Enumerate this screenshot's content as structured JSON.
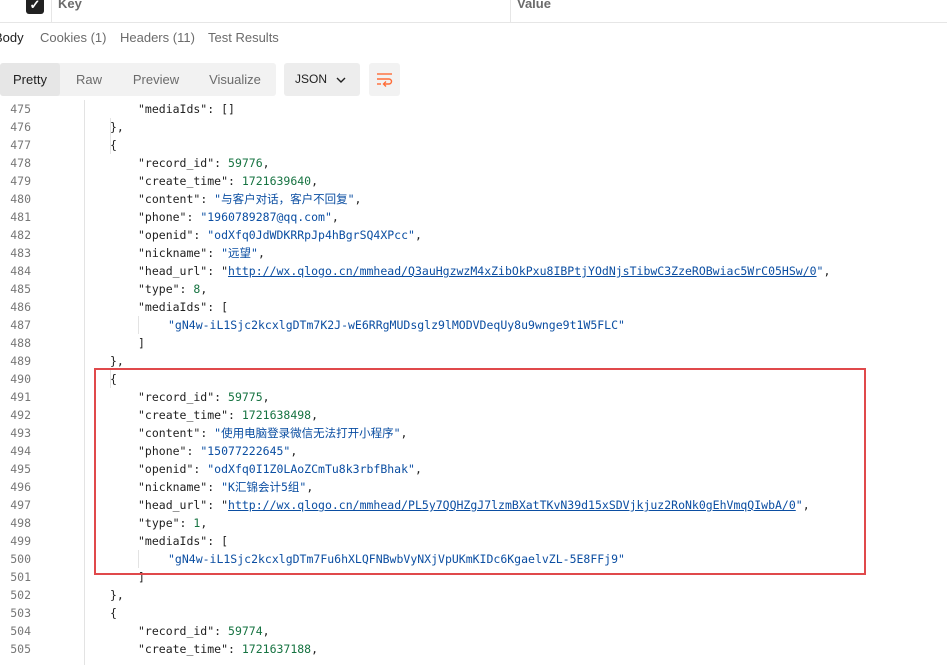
{
  "params_table": {
    "key_header": "Key",
    "value_header": "Value"
  },
  "response_tabs": [
    {
      "label": "Body",
      "active": true
    },
    {
      "label": "Cookies (1)",
      "active": false
    },
    {
      "label": "Headers (11)",
      "active": false
    },
    {
      "label": "Test Results",
      "active": false
    }
  ],
  "format_tabs": [
    {
      "label": "Pretty",
      "active": true
    },
    {
      "label": "Raw",
      "active": false
    },
    {
      "label": "Preview",
      "active": false
    },
    {
      "label": "Visualize",
      "active": false
    }
  ],
  "language_select": "JSON",
  "colors": {
    "accent": "#ff6c37",
    "highlight_box": "#e0494b",
    "string": "#0b4ea2",
    "number": "#167341"
  },
  "code_lines": [
    {
      "n": "475",
      "indent": 3,
      "tokens": [
        {
          "t": "k",
          "v": "\"mediaIds\""
        },
        {
          "t": "p",
          "v": ": []"
        }
      ]
    },
    {
      "n": "476",
      "indent": 2,
      "tokens": [
        {
          "t": "p",
          "v": "},"
        }
      ]
    },
    {
      "n": "477",
      "indent": 2,
      "tokens": [
        {
          "t": "p",
          "v": "{"
        }
      ]
    },
    {
      "n": "478",
      "indent": 3,
      "tokens": [
        {
          "t": "k",
          "v": "\"record_id\""
        },
        {
          "t": "p",
          "v": ": "
        },
        {
          "t": "n",
          "v": "59776"
        },
        {
          "t": "p",
          "v": ","
        }
      ]
    },
    {
      "n": "479",
      "indent": 3,
      "tokens": [
        {
          "t": "k",
          "v": "\"create_time\""
        },
        {
          "t": "p",
          "v": ": "
        },
        {
          "t": "n",
          "v": "1721639640"
        },
        {
          "t": "p",
          "v": ","
        }
      ]
    },
    {
      "n": "480",
      "indent": 3,
      "tokens": [
        {
          "t": "k",
          "v": "\"content\""
        },
        {
          "t": "p",
          "v": ": "
        },
        {
          "t": "s",
          "v": "\"与客户对话，客户不回复\""
        },
        {
          "t": "p",
          "v": ","
        }
      ]
    },
    {
      "n": "481",
      "indent": 3,
      "tokens": [
        {
          "t": "k",
          "v": "\"phone\""
        },
        {
          "t": "p",
          "v": ": "
        },
        {
          "t": "s",
          "v": "\"1960789287@qq.com\""
        },
        {
          "t": "p",
          "v": ","
        }
      ]
    },
    {
      "n": "482",
      "indent": 3,
      "tokens": [
        {
          "t": "k",
          "v": "\"openid\""
        },
        {
          "t": "p",
          "v": ": "
        },
        {
          "t": "s",
          "v": "\"odXfq0JdWDKRRpJp4hBgrSQ4XPcc\""
        },
        {
          "t": "p",
          "v": ","
        }
      ]
    },
    {
      "n": "483",
      "indent": 3,
      "tokens": [
        {
          "t": "k",
          "v": "\"nickname\""
        },
        {
          "t": "p",
          "v": ": "
        },
        {
          "t": "s",
          "v": "\"远望\""
        },
        {
          "t": "p",
          "v": ","
        }
      ]
    },
    {
      "n": "484",
      "indent": 3,
      "tokens": [
        {
          "t": "k",
          "v": "\"head_url\""
        },
        {
          "t": "p",
          "v": ": \""
        },
        {
          "t": "u",
          "v": "http://wx.qlogo.cn/mmhead/Q3auHgzwzM4xZibOkPxu8IBPtjYOdNjsTibwC3ZzeROBwiac5WrC05HSw/0"
        },
        {
          "t": "s",
          "v": "\""
        },
        {
          "t": "p",
          "v": ","
        }
      ]
    },
    {
      "n": "485",
      "indent": 3,
      "tokens": [
        {
          "t": "k",
          "v": "\"type\""
        },
        {
          "t": "p",
          "v": ": "
        },
        {
          "t": "n",
          "v": "8"
        },
        {
          "t": "p",
          "v": ","
        }
      ]
    },
    {
      "n": "486",
      "indent": 3,
      "tokens": [
        {
          "t": "k",
          "v": "\"mediaIds\""
        },
        {
          "t": "p",
          "v": ": ["
        }
      ]
    },
    {
      "n": "487",
      "indent": 4,
      "tokens": [
        {
          "t": "s",
          "v": "\"gN4w-iL1Sjc2kcxlgDTm7K2J-wE6RRgMUDsglz9lMODVDeqUy8u9wnge9t1W5FLC\""
        }
      ]
    },
    {
      "n": "488",
      "indent": 3,
      "tokens": [
        {
          "t": "p",
          "v": "]"
        }
      ]
    },
    {
      "n": "489",
      "indent": 2,
      "tokens": [
        {
          "t": "p",
          "v": "},"
        }
      ]
    },
    {
      "n": "490",
      "indent": 2,
      "tokens": [
        {
          "t": "p",
          "v": "{"
        }
      ]
    },
    {
      "n": "491",
      "indent": 3,
      "tokens": [
        {
          "t": "k",
          "v": "\"record_id\""
        },
        {
          "t": "p",
          "v": ": "
        },
        {
          "t": "n",
          "v": "59775"
        },
        {
          "t": "p",
          "v": ","
        }
      ]
    },
    {
      "n": "492",
      "indent": 3,
      "tokens": [
        {
          "t": "k",
          "v": "\"create_time\""
        },
        {
          "t": "p",
          "v": ": "
        },
        {
          "t": "n",
          "v": "1721638498"
        },
        {
          "t": "p",
          "v": ","
        }
      ]
    },
    {
      "n": "493",
      "indent": 3,
      "tokens": [
        {
          "t": "k",
          "v": "\"content\""
        },
        {
          "t": "p",
          "v": ": "
        },
        {
          "t": "s",
          "v": "\"使用电脑登录微信无法打开小程序\""
        },
        {
          "t": "p",
          "v": ","
        }
      ]
    },
    {
      "n": "494",
      "indent": 3,
      "tokens": [
        {
          "t": "k",
          "v": "\"phone\""
        },
        {
          "t": "p",
          "v": ": "
        },
        {
          "t": "s",
          "v": "\"15077222645\""
        },
        {
          "t": "p",
          "v": ","
        }
      ]
    },
    {
      "n": "495",
      "indent": 3,
      "tokens": [
        {
          "t": "k",
          "v": "\"openid\""
        },
        {
          "t": "p",
          "v": ": "
        },
        {
          "t": "s",
          "v": "\"odXfq0I1Z0LAoZCmTu8k3rbfBhak\""
        },
        {
          "t": "p",
          "v": ","
        }
      ]
    },
    {
      "n": "496",
      "indent": 3,
      "tokens": [
        {
          "t": "k",
          "v": "\"nickname\""
        },
        {
          "t": "p",
          "v": ": "
        },
        {
          "t": "s",
          "v": "\"K汇锦会计5组\""
        },
        {
          "t": "p",
          "v": ","
        }
      ]
    },
    {
      "n": "497",
      "indent": 3,
      "tokens": [
        {
          "t": "k",
          "v": "\"head_url\""
        },
        {
          "t": "p",
          "v": ": \""
        },
        {
          "t": "u",
          "v": "http://wx.qlogo.cn/mmhead/PL5y7QQHZgJ7lzmBXatTKvN39d15xSDVjkjuz2RoNk0gEhVmqQIwbA/0"
        },
        {
          "t": "s",
          "v": "\""
        },
        {
          "t": "p",
          "v": ","
        }
      ]
    },
    {
      "n": "498",
      "indent": 3,
      "tokens": [
        {
          "t": "k",
          "v": "\"type\""
        },
        {
          "t": "p",
          "v": ": "
        },
        {
          "t": "n",
          "v": "1"
        },
        {
          "t": "p",
          "v": ","
        }
      ]
    },
    {
      "n": "499",
      "indent": 3,
      "tokens": [
        {
          "t": "k",
          "v": "\"mediaIds\""
        },
        {
          "t": "p",
          "v": ": ["
        }
      ]
    },
    {
      "n": "500",
      "indent": 4,
      "tokens": [
        {
          "t": "s",
          "v": "\"gN4w-iL1Sjc2kcxlgDTm7Fu6hXLQFNBwbVyNXjVpUKmKIDc6KgaelvZL-5E8FFj9\""
        }
      ]
    },
    {
      "n": "501",
      "indent": 3,
      "tokens": [
        {
          "t": "p",
          "v": "]"
        }
      ]
    },
    {
      "n": "502",
      "indent": 2,
      "tokens": [
        {
          "t": "p",
          "v": "},"
        }
      ]
    },
    {
      "n": "503",
      "indent": 2,
      "tokens": [
        {
          "t": "p",
          "v": "{"
        }
      ]
    },
    {
      "n": "504",
      "indent": 3,
      "tokens": [
        {
          "t": "k",
          "v": "\"record_id\""
        },
        {
          "t": "p",
          "v": ": "
        },
        {
          "t": "n",
          "v": "59774"
        },
        {
          "t": "p",
          "v": ","
        }
      ]
    },
    {
      "n": "505",
      "indent": 3,
      "tokens": [
        {
          "t": "k",
          "v": "\"create_time\""
        },
        {
          "t": "p",
          "v": ": "
        },
        {
          "t": "n",
          "v": "1721637188"
        },
        {
          "t": "p",
          "v": ","
        }
      ]
    }
  ]
}
